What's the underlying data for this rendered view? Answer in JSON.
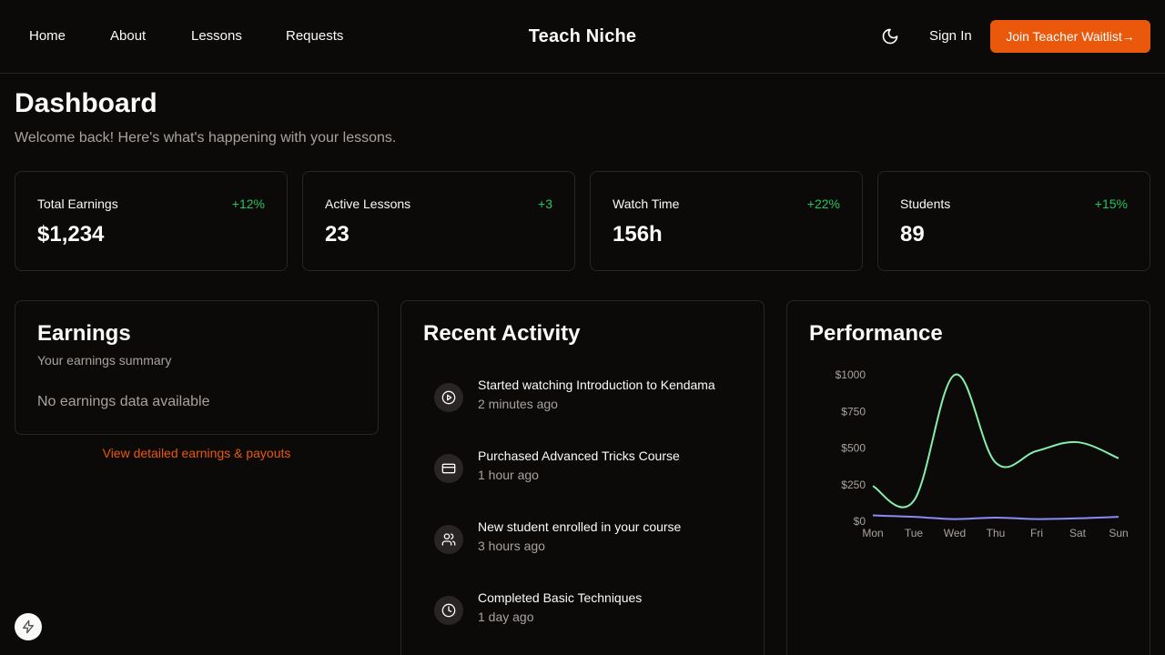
{
  "header": {
    "nav": [
      "Home",
      "About",
      "Lessons",
      "Requests"
    ],
    "brand": "Teach Niche",
    "theme_icon": "moon-icon",
    "sign_in": "Sign In",
    "cta": "Join Teacher Waitlist→",
    "cta_color": "#ea580c"
  },
  "page": {
    "title": "Dashboard",
    "subtitle": "Welcome back! Here's what's happening with your lessons."
  },
  "stats": [
    {
      "label": "Total Earnings",
      "change": "+12%",
      "value": "$1,234"
    },
    {
      "label": "Active Lessons",
      "change": "+3",
      "value": "23"
    },
    {
      "label": "Watch Time",
      "change": "+22%",
      "value": "156h"
    },
    {
      "label": "Students",
      "change": "+15%",
      "value": "89"
    }
  ],
  "earnings": {
    "title": "Earnings",
    "subtitle": "Your earnings summary",
    "empty": "No earnings data available",
    "link": "View detailed earnings & payouts"
  },
  "activity": {
    "title": "Recent Activity",
    "items": [
      {
        "icon": "play-circle-icon",
        "text": "Started watching Introduction to Kendama",
        "time": "2 minutes ago"
      },
      {
        "icon": "credit-card-icon",
        "text": "Purchased Advanced Tricks Course",
        "time": "1 hour ago"
      },
      {
        "icon": "users-icon",
        "text": "New student enrolled in your course",
        "time": "3 hours ago"
      },
      {
        "icon": "clock-icon",
        "text": "Completed Basic Techniques",
        "time": "1 day ago"
      }
    ]
  },
  "performance": {
    "title": "Performance"
  },
  "chart_data": {
    "type": "line",
    "categories": [
      "Mon",
      "Tue",
      "Wed",
      "Thu",
      "Fri",
      "Sat",
      "Sun"
    ],
    "y_ticks": [
      "$0",
      "$250",
      "$500",
      "$750",
      "$1000"
    ],
    "ylim": [
      0,
      1000
    ],
    "series": [
      {
        "values": [
          240,
          140,
          1000,
          400,
          480,
          540,
          430
        ],
        "color": "#86efac"
      },
      {
        "values": [
          40,
          30,
          15,
          25,
          15,
          20,
          30
        ],
        "color": "#8b8bf5"
      }
    ],
    "grid": false,
    "legend": false
  },
  "badge_icon": "lightning-icon"
}
